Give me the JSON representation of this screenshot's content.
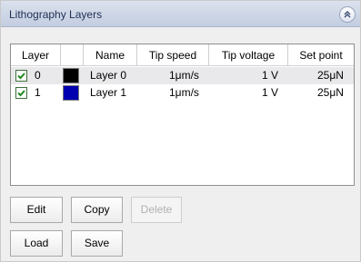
{
  "window": {
    "title": "Lithography Layers",
    "accent_color": "#c3cde0"
  },
  "table": {
    "columns": [
      "Layer",
      "Name",
      "Tip speed",
      "Tip voltage",
      "Set point"
    ],
    "rows": [
      {
        "checked": true,
        "index": "0",
        "color": "#000000",
        "name": "Layer 0",
        "tip_speed": "1μm/s",
        "tip_voltage": "1 V",
        "set_point": "25μN"
      },
      {
        "checked": true,
        "index": "1",
        "color": "#0000b0",
        "name": "Layer 1",
        "tip_speed": "1μm/s",
        "tip_voltage": "1 V",
        "set_point": "25μN"
      }
    ]
  },
  "buttons": {
    "edit": "Edit",
    "copy": "Copy",
    "delete": "Delete",
    "load": "Load",
    "save": "Save"
  }
}
